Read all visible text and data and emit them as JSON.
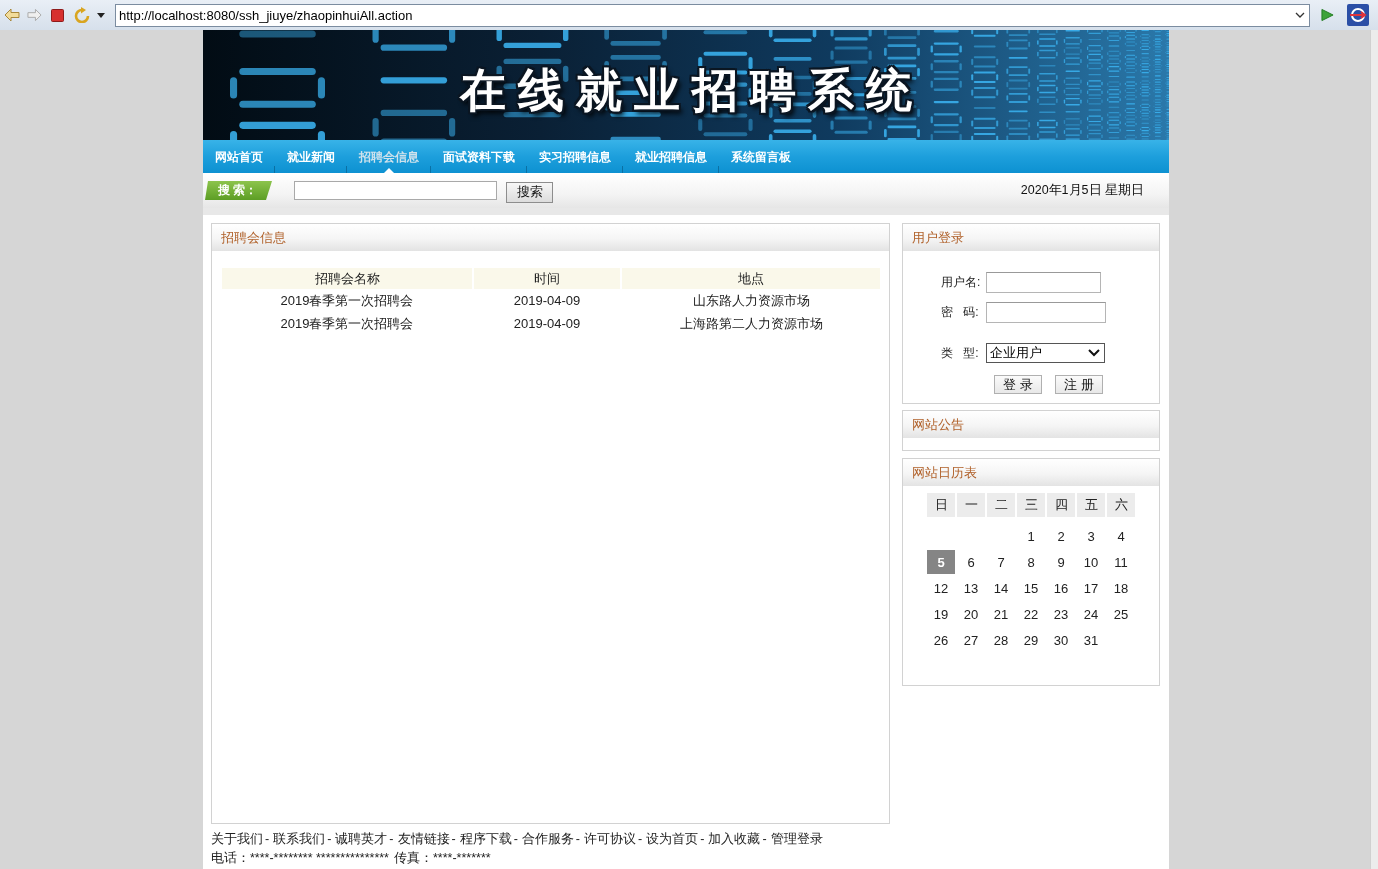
{
  "browser": {
    "url": "http://localhost:8080/ssh_jiuye/zhaopinhuiAll.action"
  },
  "banner": {
    "title": "在线就业招聘系统"
  },
  "nav": [
    {
      "label": "网站首页",
      "selected": false
    },
    {
      "label": "就业新闻",
      "selected": false
    },
    {
      "label": "招聘会信息",
      "selected": true
    },
    {
      "label": "面试资料下载",
      "selected": false
    },
    {
      "label": "实习招聘信息",
      "selected": false
    },
    {
      "label": "就业招聘信息",
      "selected": false
    },
    {
      "label": "系统留言板",
      "selected": false
    }
  ],
  "search": {
    "label": "搜 索：",
    "button": "搜索",
    "date": "2020年1月5日 星期日"
  },
  "fairs": {
    "title": "招聘会信息",
    "columns": [
      "招聘会名称",
      "时间",
      "地点"
    ],
    "rows": [
      [
        "2019春季第一次招聘会",
        "2019-04-09",
        "山东路人力资源市场"
      ],
      [
        "2019春季第一次招聘会",
        "2019-04-09",
        "上海路第二人力资源市场"
      ]
    ]
  },
  "login": {
    "title": "用户登录",
    "fields": [
      {
        "kind": "text",
        "label": "用户名:"
      },
      {
        "kind": "password",
        "label": "密 码:"
      },
      {
        "kind": "select",
        "label": "类 型:",
        "value": "企业用户"
      }
    ],
    "buttons": [
      "登 录",
      "注 册"
    ]
  },
  "notice": {
    "title": "网站公告"
  },
  "calendar": {
    "title": "网站日历表",
    "weekdays": [
      "日",
      "一",
      "二",
      "三",
      "四",
      "五",
      "六"
    ],
    "weeks": [
      [
        {
          "kind": "blank"
        },
        {
          "kind": "blank"
        },
        {
          "kind": "blank"
        },
        {
          "kind": "day",
          "day": "1",
          "selected": false
        },
        {
          "kind": "day",
          "day": "2",
          "selected": false
        },
        {
          "kind": "day",
          "day": "3",
          "selected": false
        },
        {
          "kind": "day",
          "day": "4",
          "selected": false
        }
      ],
      [
        {
          "kind": "day",
          "day": "5",
          "selected": true
        },
        {
          "kind": "day",
          "day": "6",
          "selected": false
        },
        {
          "kind": "day",
          "day": "7",
          "selected": false
        },
        {
          "kind": "day",
          "day": "8",
          "selected": false
        },
        {
          "kind": "day",
          "day": "9",
          "selected": false
        },
        {
          "kind": "day",
          "day": "10",
          "selected": false
        },
        {
          "kind": "day",
          "day": "11",
          "selected": false
        }
      ],
      [
        {
          "kind": "day",
          "day": "12",
          "selected": false
        },
        {
          "kind": "day",
          "day": "13",
          "selected": false
        },
        {
          "kind": "day",
          "day": "14",
          "selected": false
        },
        {
          "kind": "day",
          "day": "15",
          "selected": false
        },
        {
          "kind": "day",
          "day": "16",
          "selected": false
        },
        {
          "kind": "day",
          "day": "17",
          "selected": false
        },
        {
          "kind": "day",
          "day": "18",
          "selected": false
        }
      ],
      [
        {
          "kind": "day",
          "day": "19",
          "selected": false
        },
        {
          "kind": "day",
          "day": "20",
          "selected": false
        },
        {
          "kind": "day",
          "day": "21",
          "selected": false
        },
        {
          "kind": "day",
          "day": "22",
          "selected": false
        },
        {
          "kind": "day",
          "day": "23",
          "selected": false
        },
        {
          "kind": "day",
          "day": "24",
          "selected": false
        },
        {
          "kind": "day",
          "day": "25",
          "selected": false
        }
      ],
      [
        {
          "kind": "day",
          "day": "26",
          "selected": false
        },
        {
          "kind": "day",
          "day": "27",
          "selected": false
        },
        {
          "kind": "day",
          "day": "28",
          "selected": false
        },
        {
          "kind": "day",
          "day": "29",
          "selected": false
        },
        {
          "kind": "day",
          "day": "30",
          "selected": false
        },
        {
          "kind": "day",
          "day": "31",
          "selected": false
        }
      ]
    ]
  },
  "footer": {
    "links": [
      {
        "label": "关于我们",
        "separator": "-"
      },
      {
        "label": "联系我们",
        "separator": "-"
      },
      {
        "label": "诚聘英才",
        "separator": "-"
      },
      {
        "label": "友情链接",
        "separator": "-"
      },
      {
        "label": "程序下载",
        "separator": "-"
      },
      {
        "label": "合作服务",
        "separator": "-"
      },
      {
        "label": "许可协议",
        "separator": "-"
      },
      {
        "label": "设为首页",
        "separator": "-"
      },
      {
        "label": "加入收藏",
        "separator": "-"
      },
      {
        "label": "管理登录"
      }
    ],
    "phone": "电话：****-******** ***************",
    "fax": "传真：****-*******"
  }
}
